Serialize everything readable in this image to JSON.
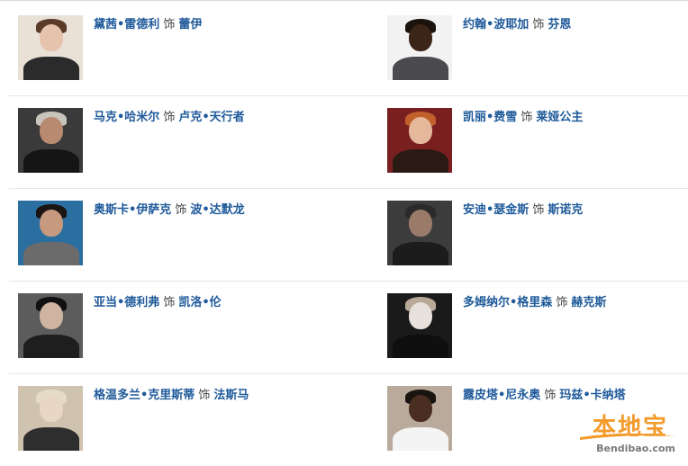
{
  "separator": "饰",
  "rows": [
    {
      "left": {
        "actor": "黛茜•雷德利",
        "role": "蕾伊",
        "colors": {
          "bg": "#e9e0d6",
          "hair": "#5a3a28",
          "skin": "#e6c3ad",
          "body": "#2b2b2b"
        }
      },
      "right": {
        "actor": "约翰•波耶加",
        "role": "芬恩",
        "colors": {
          "bg": "#f2f2f2",
          "hair": "#1c120c",
          "skin": "#3b2418",
          "body": "#4a4a4f"
        }
      }
    },
    {
      "left": {
        "actor": "马克•哈米尔",
        "role": "卢克•天行者",
        "colors": {
          "bg": "#3a3a3a",
          "hair": "#c9c4bc",
          "skin": "#b88b71",
          "body": "#151515"
        }
      },
      "right": {
        "actor": "凯丽•费雪",
        "role": "莱娅公主",
        "colors": {
          "bg": "#7a1f1f",
          "hair": "#c0602a",
          "skin": "#e5b89c",
          "body": "#2a1a14"
        }
      }
    },
    {
      "left": {
        "actor": "奥斯卡•伊萨克",
        "role": "波•达默龙",
        "colors": {
          "bg": "#2b6fa0",
          "hair": "#1a1412",
          "skin": "#c79a80",
          "body": "#6b6b6b"
        }
      },
      "right": {
        "actor": "安迪•瑟金斯",
        "role": "斯诺克",
        "colors": {
          "bg": "#3c3c3c",
          "hair": "#2a2a2a",
          "skin": "#9a7a68",
          "body": "#1c1c1c"
        }
      }
    },
    {
      "left": {
        "actor": "亚当•德利弗",
        "role": "凯洛•伦",
        "colors": {
          "bg": "#5c5c5c",
          "hair": "#111111",
          "skin": "#d0b4a2",
          "body": "#1e1e1e"
        }
      },
      "right": {
        "actor": "多姆纳尔•格里森",
        "role": "赫克斯",
        "colors": {
          "bg": "#1a1a1a",
          "hair": "#b8a898",
          "skin": "#e8e0da",
          "body": "#0f0f0f"
        }
      }
    },
    {
      "left": {
        "actor": "格温多兰•克里斯蒂",
        "role": "法斯马",
        "colors": {
          "bg": "#cfc3b0",
          "hair": "#e6dcc6",
          "skin": "#e9d7c6",
          "body": "#2e2e2e"
        }
      },
      "right": {
        "actor": "露皮塔•尼永奥",
        "role": "玛兹•卡纳塔",
        "colors": {
          "bg": "#b9aa9c",
          "hair": "#1a1410",
          "skin": "#4a2e22",
          "body": "#f4f4f4"
        }
      }
    }
  ],
  "watermark": {
    "brand": "本地宝",
    "url": "Bendibao.com",
    "color": "#f39a2b"
  }
}
